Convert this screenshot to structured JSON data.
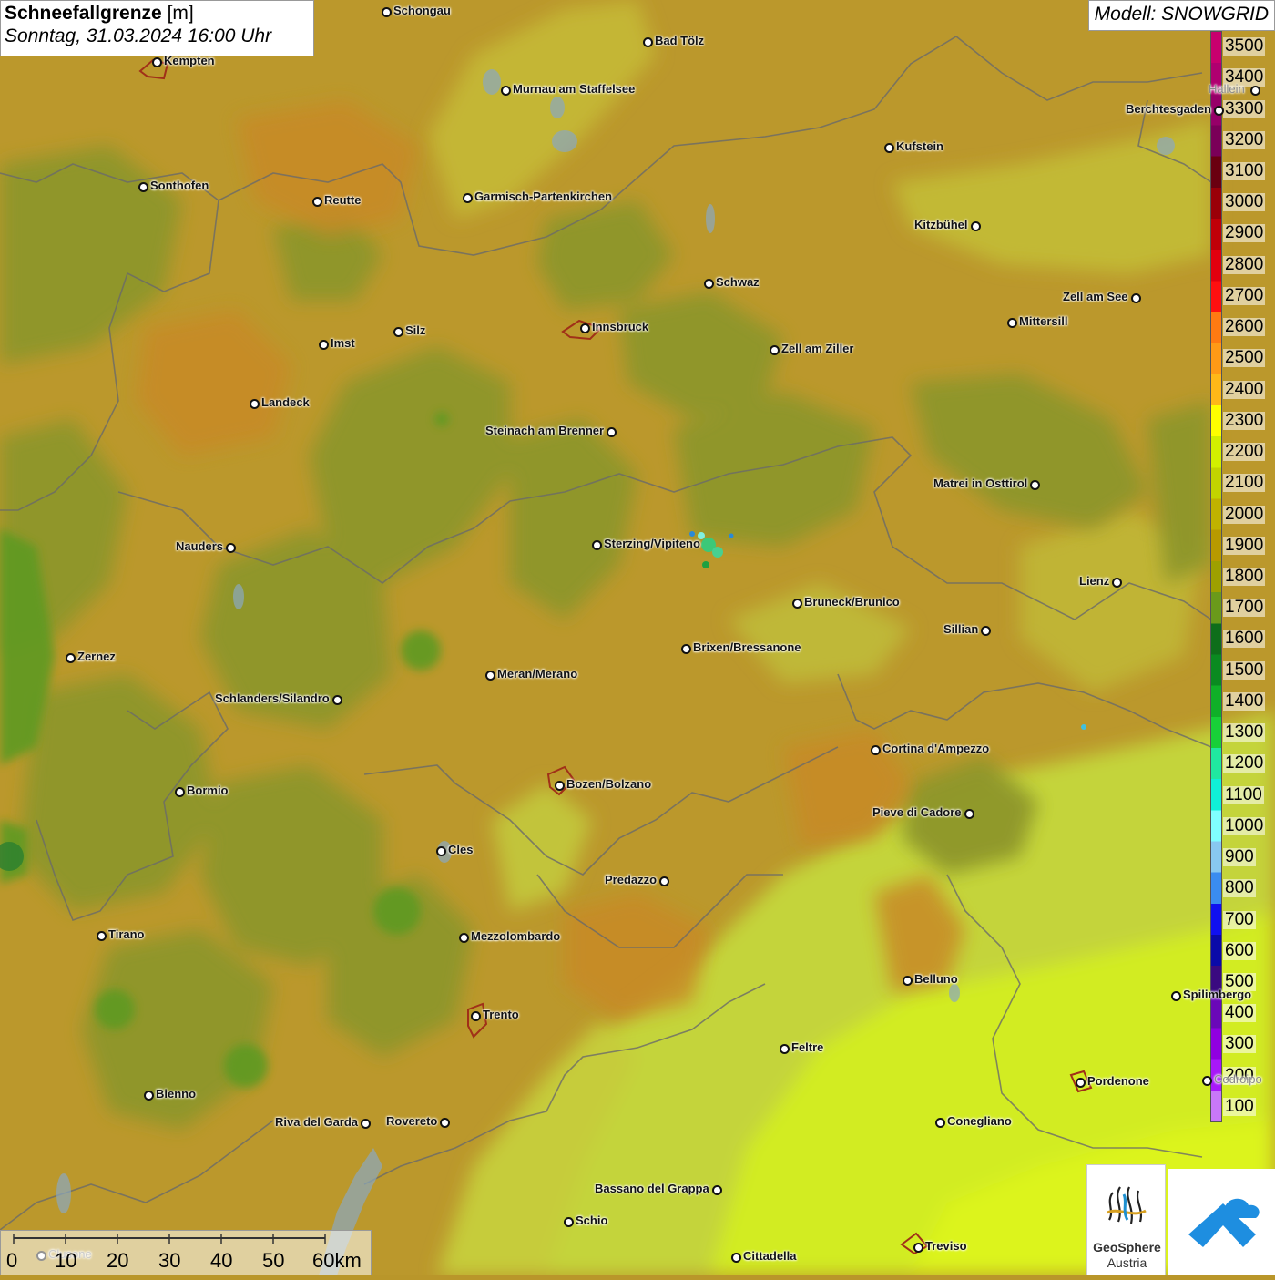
{
  "header": {
    "title_bold": "Schneefallgrenze",
    "title_unit": "[m]",
    "subtitle": "Sonntag, 31.03.2024 16:00 Uhr",
    "model": "Modell: SNOWGRID"
  },
  "legend": {
    "labels": [
      "3500",
      "3400",
      "3300",
      "3200",
      "3100",
      "3000",
      "2900",
      "2800",
      "2700",
      "2600",
      "2500",
      "2400",
      "2300",
      "2200",
      "2100",
      "2000",
      "1900",
      "1800",
      "1700",
      "1600",
      "1500",
      "1400",
      "1300",
      "1200",
      "1100",
      "1000",
      "900",
      "800",
      "700",
      "600",
      "500",
      "400",
      "300",
      "200",
      "100"
    ],
    "colors": [
      "#c8006e",
      "#b00070",
      "#960068",
      "#7a0058",
      "#6a0010",
      "#9a0008",
      "#c00008",
      "#e2000e",
      "#ff1010",
      "#ff7a12",
      "#ff9a16",
      "#ffb818",
      "#ffff00",
      "#d2f000",
      "#c2d400",
      "#c0b200",
      "#b89a00",
      "#9ea000",
      "#6a9a1a",
      "#0e6e1a",
      "#0a8a20",
      "#10b028",
      "#18d038",
      "#20e8a0",
      "#10f0d8",
      "#80ffff",
      "#88c8f0",
      "#3a8cf0",
      "#1010f0",
      "#0a0aa8",
      "#3a0a80",
      "#6a08b8",
      "#9000e0",
      "#a818f8",
      "#c878f8"
    ]
  },
  "cities": [
    {
      "name": "Schongau"
    },
    {
      "name": "Bad Tölz"
    },
    {
      "name": "Kempten"
    },
    {
      "name": "Murnau am Staffelsee"
    },
    {
      "name": "Hallein"
    },
    {
      "name": "Berchtesgaden"
    },
    {
      "name": "Kufstein"
    },
    {
      "name": "Sonthofen"
    },
    {
      "name": "Reutte"
    },
    {
      "name": "Garmisch-Partenkirchen"
    },
    {
      "name": "Kitzbühel"
    },
    {
      "name": "Schwaz"
    },
    {
      "name": "Zell am See"
    },
    {
      "name": "Mittersill"
    },
    {
      "name": "Innsbruck"
    },
    {
      "name": "Imst"
    },
    {
      "name": "Silz"
    },
    {
      "name": "Zell am Ziller"
    },
    {
      "name": "Landeck"
    },
    {
      "name": "Steinach am Brenner"
    },
    {
      "name": "Matrei in Osttirol"
    },
    {
      "name": "Nauders"
    },
    {
      "name": "Sterzing/Vipiteno"
    },
    {
      "name": "Lienz"
    },
    {
      "name": "Bruneck/Brunico"
    },
    {
      "name": "Sillian"
    },
    {
      "name": "Zernez"
    },
    {
      "name": "Brixen/Bressanone"
    },
    {
      "name": "Meran/Merano"
    },
    {
      "name": "Schlanders/Silandro"
    },
    {
      "name": "Cortina d'Ampezzo"
    },
    {
      "name": "Bormio"
    },
    {
      "name": "Bozen/Bolzano"
    },
    {
      "name": "Pieve di Cadore"
    },
    {
      "name": "Cles"
    },
    {
      "name": "Predazzo"
    },
    {
      "name": "Tirano"
    },
    {
      "name": "Mezzolombardo"
    },
    {
      "name": "Belluno"
    },
    {
      "name": "Spilimbergo"
    },
    {
      "name": "Trento"
    },
    {
      "name": "Feltre"
    },
    {
      "name": "Bienno"
    },
    {
      "name": "Pordenone"
    },
    {
      "name": "Codroipo"
    },
    {
      "name": "Riva del Garda"
    },
    {
      "name": "Rovereto"
    },
    {
      "name": "Conegliano"
    },
    {
      "name": "Bassano del Grappa"
    },
    {
      "name": "Schio"
    },
    {
      "name": "Treviso"
    },
    {
      "name": "Cittadella"
    },
    {
      "name": "Clusone"
    }
  ],
  "scale": {
    "labels": [
      "0",
      "10",
      "20",
      "30",
      "40",
      "50",
      "60km"
    ]
  },
  "logo": {
    "line1": "GeoSphere",
    "line2": "Austria"
  }
}
